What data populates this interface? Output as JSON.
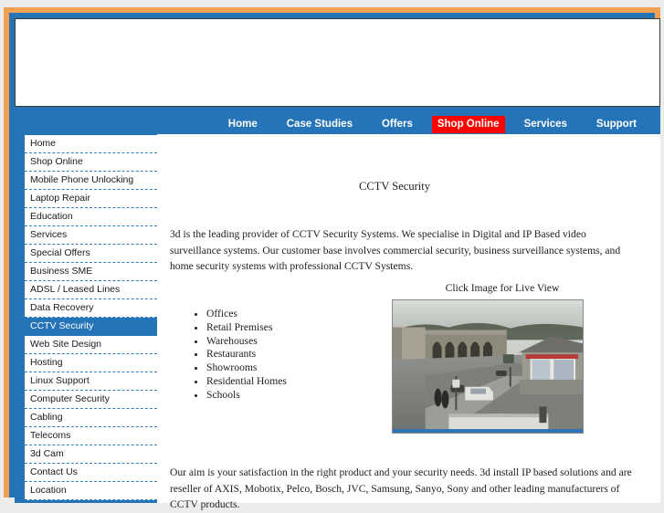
{
  "site": {
    "frame_accent_color": "#f2a051",
    "brand_blue": "#2574b8",
    "highlight_red": "#ff0000"
  },
  "nav": {
    "items": [
      {
        "label": "Home",
        "highlight": false
      },
      {
        "label": "Case Studies",
        "highlight": false
      },
      {
        "label": "Offers",
        "highlight": false
      },
      {
        "label": "Shop Online",
        "highlight": true
      },
      {
        "label": "Services",
        "highlight": false
      },
      {
        "label": "Support",
        "highlight": false
      }
    ]
  },
  "sidebar": {
    "items": [
      {
        "label": "Home",
        "active": false
      },
      {
        "label": "Shop Online",
        "active": false
      },
      {
        "label": "Mobile Phone Unlocking",
        "active": false
      },
      {
        "label": "Laptop Repair",
        "active": false
      },
      {
        "label": "Education",
        "active": false
      },
      {
        "label": "Services",
        "active": false
      },
      {
        "label": "Special Offers",
        "active": false
      },
      {
        "label": "Business SME",
        "active": false
      },
      {
        "label": "ADSL / Leased Lines",
        "active": false
      },
      {
        "label": "Data Recovery",
        "active": false
      },
      {
        "label": "CCTV Security",
        "active": true
      },
      {
        "label": "Web Site Design",
        "active": false
      },
      {
        "label": "Hosting",
        "active": false
      },
      {
        "label": "Linux Support",
        "active": false
      },
      {
        "label": "Computer Security",
        "active": false
      },
      {
        "label": "Cabling",
        "active": false
      },
      {
        "label": "Telecoms",
        "active": false
      },
      {
        "label": "3d Cam",
        "active": false
      },
      {
        "label": "Contact Us",
        "active": false
      },
      {
        "label": "Location",
        "active": false
      }
    ]
  },
  "main": {
    "title": "CCTV Security",
    "intro": "3d  is the leading provider of CCTV Security Systems. We specialise in Digital and IP Based video surveillance systems. Our customer base involves commercial security, business surveillance systems, and home security systems with professional CCTV Systems.",
    "bullets": [
      "Offices",
      "Retail Premises",
      "Warehouses",
      "Restaurants",
      "Showrooms",
      "Residential Homes",
      "Schools"
    ],
    "camera_caption": "Click Image for Live View",
    "outro": "Our aim is your satisfaction in the right product and your security needs. 3d install IP based solutions and are reseller of AXIS, Mobotix, Pelco, Bosch, JVC, Samsung, Sanyo, Sony and other leading manufacturers of CCTV products."
  }
}
